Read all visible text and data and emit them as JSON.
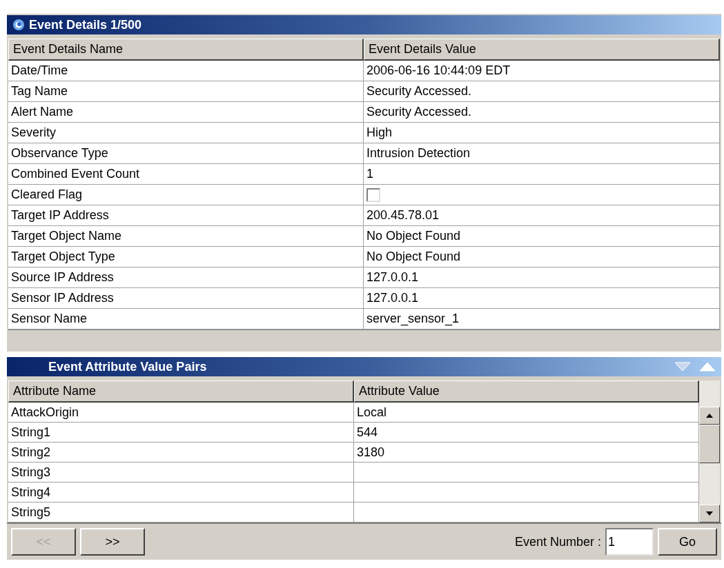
{
  "details_panel": {
    "title": "Event Details 1/500",
    "columns": [
      "Event Details Name",
      "Event Details Value"
    ],
    "rows": [
      {
        "kind": "text",
        "name": "Date/Time",
        "value": "2006-06-16 10:44:09 EDT"
      },
      {
        "kind": "text",
        "name": "Tag Name",
        "value": "Security Accessed."
      },
      {
        "kind": "text",
        "name": "Alert Name",
        "value": "Security Accessed."
      },
      {
        "kind": "text",
        "name": "Severity",
        "value": "High"
      },
      {
        "kind": "text",
        "name": "Observance Type",
        "value": "Intrusion Detection"
      },
      {
        "kind": "text",
        "name": "Combined Event Count",
        "value": "1"
      },
      {
        "kind": "checkbox",
        "name": "Cleared Flag",
        "checked": false
      },
      {
        "kind": "text",
        "name": "Target IP Address",
        "value": "200.45.78.01"
      },
      {
        "kind": "text",
        "name": "Target Object Name",
        "value": "No Object Found"
      },
      {
        "kind": "text",
        "name": "Target Object Type",
        "value": "No Object Found"
      },
      {
        "kind": "text",
        "name": "Source IP Address",
        "value": "127.0.0.1"
      },
      {
        "kind": "text",
        "name": "Sensor IP Address",
        "value": "127.0.0.1"
      },
      {
        "kind": "text",
        "name": "Sensor Name",
        "value": "server_sensor_1"
      }
    ]
  },
  "attributes_panel": {
    "title": "Event Attribute Value Pairs",
    "columns": [
      "Attribute Name",
      "Attribute Value"
    ],
    "rows": [
      {
        "name": "AttackOrigin",
        "value": "Local"
      },
      {
        "name": "String1",
        "value": "544"
      },
      {
        "name": "String2",
        "value": "3180"
      },
      {
        "name": "String3"
      },
      {
        "name": "String4"
      },
      {
        "name": "String5"
      }
    ]
  },
  "footer": {
    "prev_button": {
      "label": "<<",
      "disabled": true
    },
    "next_button": {
      "label": ">>",
      "disabled": false
    },
    "event_number_label": "Event Number :",
    "event_number_value": "1",
    "go_button": "Go"
  }
}
